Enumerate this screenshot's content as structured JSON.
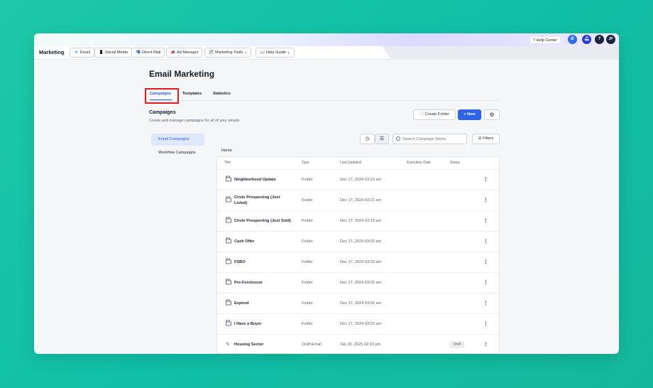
{
  "topbar": {
    "help_center": "? Help Center",
    "avatar_initials": "JP",
    "question": "?"
  },
  "nav": {
    "brand": "Marketing",
    "items": [
      {
        "label": "Email",
        "icon": "📧"
      },
      {
        "label": "Social Media",
        "icon": "📱"
      },
      {
        "label": "Direct Mail",
        "icon": "📬"
      },
      {
        "label": "Ad Manager",
        "icon": "📣"
      },
      {
        "label": "Marketing Tools",
        "icon": "🛠"
      },
      {
        "label": "Help Guide",
        "icon": "📖"
      }
    ]
  },
  "page": {
    "title": "Email Marketing",
    "tabs": [
      "Campaigns",
      "Templates",
      "Statistics"
    ],
    "section_title": "Campaigns",
    "section_subtitle": "Create and manage campaigns for all of your emails",
    "create_folder": "Create Folder",
    "new_button": "New",
    "filters": "Filters",
    "search_placeholder": "Search Campaign Name",
    "breadcrumb": "Home"
  },
  "sidebar": {
    "items": [
      "Email Campaigns",
      "Workflow Campaigns"
    ]
  },
  "table": {
    "columns": [
      "Title",
      "Type",
      "Last Updated",
      "Execution Date",
      "Status"
    ],
    "rows": [
      {
        "title": "Neighborhood Update",
        "type": "Folder",
        "updated": "Dec 17, 2024 03:23 am",
        "status": "",
        "icon": "folder-icon"
      },
      {
        "title": "Circle Prospecting (Just Listed)",
        "type": "Folder",
        "updated": "Dec 17, 2024 03:21 am",
        "status": "",
        "icon": "folder-icon"
      },
      {
        "title": "Circle Prospecting (Just Sold)",
        "type": "Folder",
        "updated": "Dec 17, 2024 03:19 am",
        "status": "",
        "icon": "folder-icon"
      },
      {
        "title": "Cash Offer",
        "type": "Folder",
        "updated": "Dec 17, 2024 03:03 am",
        "status": "",
        "icon": "folder-icon"
      },
      {
        "title": "FSBO",
        "type": "Folder",
        "updated": "Dec 17, 2024 03:03 am",
        "status": "",
        "icon": "folder-icon"
      },
      {
        "title": "Pre-Forclosure",
        "type": "Folder",
        "updated": "Dec 17, 2024 03:02 am",
        "status": "",
        "icon": "folder-icon"
      },
      {
        "title": "Expired",
        "type": "Folder",
        "updated": "Dec 17, 2024 03:02 am",
        "status": "",
        "icon": "folder-icon"
      },
      {
        "title": "I Have a Buyer",
        "type": "Folder",
        "updated": "Dec 17, 2024 03:02 am",
        "status": "",
        "icon": "folder-icon"
      },
      {
        "title": "Housing Sector",
        "type": "Draft Email",
        "updated": "Jan 30, 2025 02:23 pm",
        "status": "Draft",
        "icon": "edit-icon"
      }
    ]
  },
  "colors": {
    "accent": "#2e63e8",
    "highlight": "#e11b22",
    "background": "#10bfa6"
  }
}
